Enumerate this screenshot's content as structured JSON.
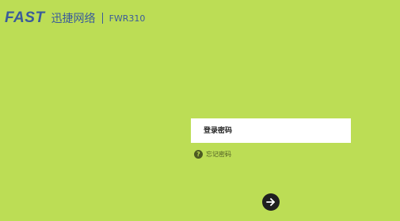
{
  "header": {
    "brand": "FAST",
    "brand_cn": "迅捷网络",
    "model": "FWR310"
  },
  "login": {
    "password_placeholder": "登录密码",
    "forgot_label": "忘记密码",
    "submit_icon": "arrow-right-icon"
  },
  "colors": {
    "background": "#bcdd55",
    "brand": "#3a5b9b",
    "button": "#1f1f1f"
  }
}
